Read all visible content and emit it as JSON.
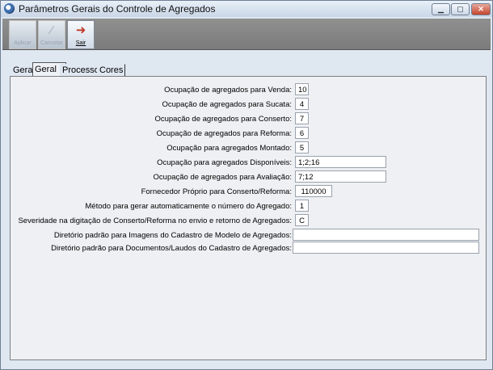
{
  "window": {
    "title": "Parâmetros Gerais do Controle de Agregados"
  },
  "toolbar": {
    "apply_label": "Aplicar",
    "cancel_label": "Cancelar",
    "exit_label": "Sair"
  },
  "tabs": [
    {
      "label": "Geral"
    },
    {
      "label": "Geral II"
    },
    {
      "label": "Processos"
    },
    {
      "label": "Cores"
    }
  ],
  "selected_tab": "Geral II",
  "fields": [
    {
      "label": "Ocupação de agregados para Venda:",
      "value": "10"
    },
    {
      "label": "Ocupação de agregados para Sucata:",
      "value": "4"
    },
    {
      "label": "Ocupação de agregados para Conserto:",
      "value": "7"
    },
    {
      "label": "Ocupação de agregados para Reforma:",
      "value": "6"
    },
    {
      "label": "Ocupação para agregados Montado:",
      "value": "5"
    },
    {
      "label": "Ocupação para agregados Disponíveis:",
      "value": "1;2;16"
    },
    {
      "label": "Ocupação de agregados para Avaliação:",
      "value": "7;12"
    },
    {
      "label": "Fornecedor Próprio para Conserto/Reforma:",
      "value": "110000"
    },
    {
      "label": "Método para gerar automaticamente o número do Agregado:",
      "value": "1"
    },
    {
      "label": "Severidade na digitação de Conserto/Reforma no envio e retorno de Agregados:",
      "value": "C"
    },
    {
      "label": "Diretório padrão para Imagens do Cadastro de Modelo de Agregados:",
      "value": ""
    },
    {
      "label": "Diretório padrão para Documentos/Laudos do Cadastro de Agregados:",
      "value": ""
    }
  ],
  "colors": {
    "exit_icon": "#c0392b",
    "accent": "#3e6fb0"
  }
}
